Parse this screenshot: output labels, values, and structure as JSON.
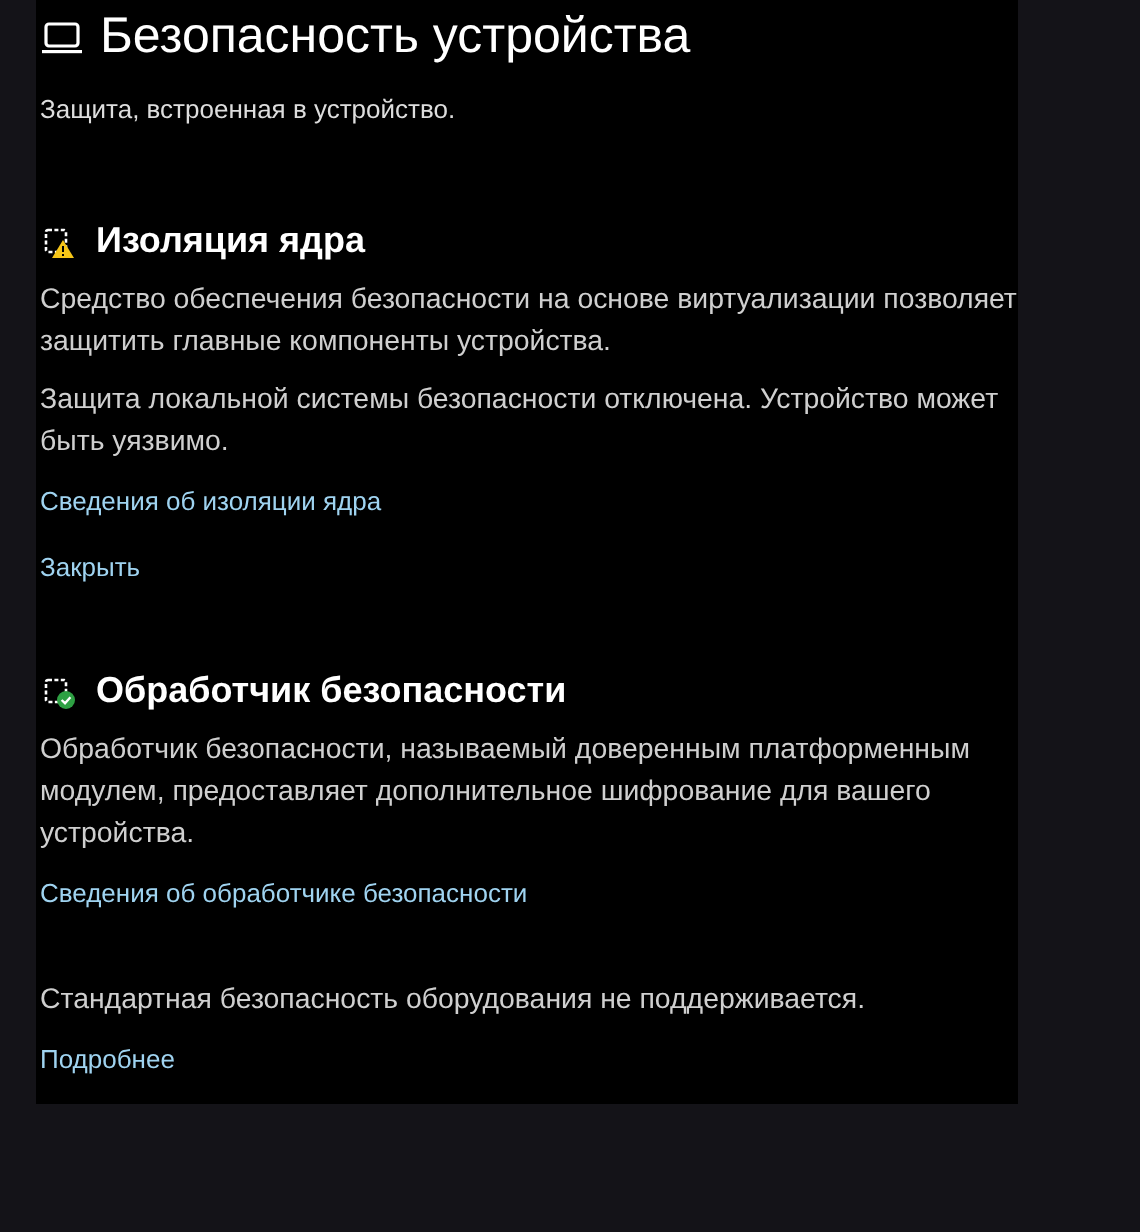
{
  "header": {
    "title": "Безопасность устройства",
    "subtitle": "Защита, встроенная в устройство."
  },
  "sections": [
    {
      "kind": "warning",
      "title": "Изоляция ядра",
      "paragraphs": [
        "Средство обеспечения безопасности на основе виртуализации позволяет защитить главные компоненты устройства.",
        "Защита локальной системы безопасности отключена. Устройство может быть уязвимо."
      ],
      "links": [
        "Сведения об изоляции ядра",
        "Закрыть"
      ]
    },
    {
      "kind": "ok",
      "title": "Обработчик безопасности",
      "paragraphs": [
        "Обработчик безопасности, называемый доверенным платформенным модулем, предоставляет дополнительное шифрование для вашего устройства."
      ],
      "links": [
        "Сведения об обработчике безопасности"
      ]
    },
    {
      "paragraphs": [
        "Стандартная безопасность оборудования не поддерживается."
      ],
      "links": [
        "Подробнее"
      ]
    }
  ]
}
